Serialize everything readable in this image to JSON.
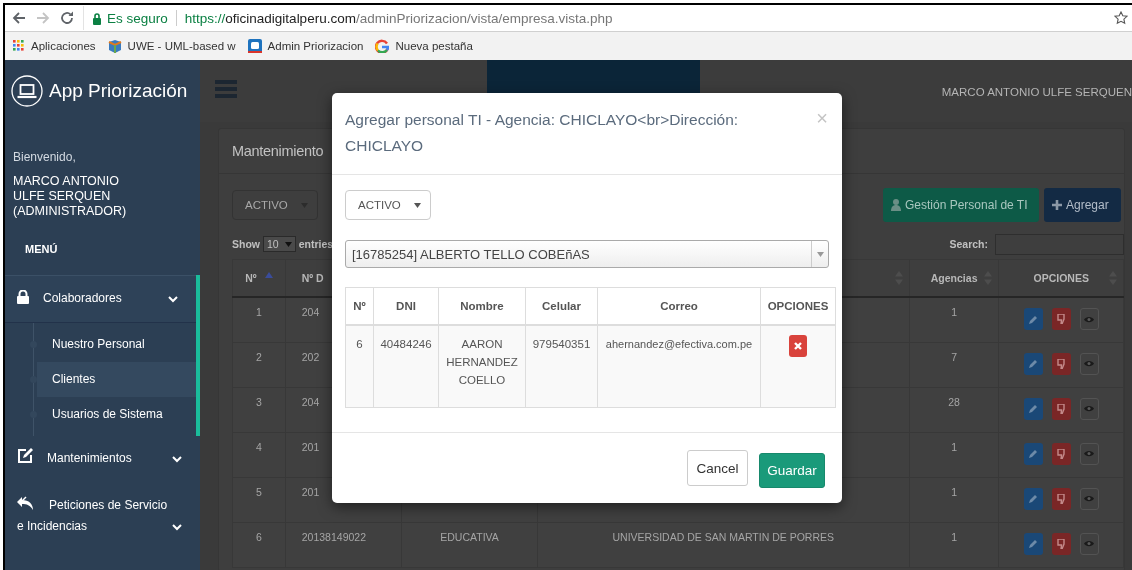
{
  "browser": {
    "security_label": "Es seguro",
    "url_scheme": "https://",
    "url_host": "oficinadigitalperu.com",
    "url_path": "/adminPriorizacion/vista/empresa.vista.php",
    "bookmarks": [
      {
        "label": "Aplicaciones",
        "kind": "apps"
      },
      {
        "label": "UWE - UML-based w",
        "kind": "uwe"
      },
      {
        "label": "Admin Priorizacion",
        "kind": "square"
      },
      {
        "label": "Nueva pestaña",
        "kind": "ring"
      }
    ]
  },
  "sidebar": {
    "brand": "App Priorización",
    "welcome": "Bienvenido,",
    "user_name": "MARCO ANTONIO ULFE SERQUEN (ADMINISTRADOR)",
    "menu_heading": "MENÚ",
    "items": [
      {
        "label": "Colaboradores",
        "expanded": true,
        "children": [
          {
            "label": "Nuestro Personal",
            "selected": false
          },
          {
            "label": "Clientes",
            "selected": true
          },
          {
            "label": "Usuarios de Sistema",
            "selected": false
          }
        ]
      },
      {
        "label": "Mantenimientos",
        "expanded": false
      },
      {
        "label": "Peticiones de Servicio e Incidencias",
        "expanded": false
      }
    ]
  },
  "topbar": {
    "user": "MARCO ANTONIO ULFE SERQUEN"
  },
  "panel": {
    "title": "Mantenimiento",
    "status_filter": "ACTIVO",
    "buttons": [
      {
        "label": "Gestión Personal de TI",
        "kind": "success"
      },
      {
        "label": "Agregar",
        "kind": "primary"
      }
    ],
    "show_label": "Show",
    "page_size": "10",
    "entries_label": "entries",
    "search_label": "Search:",
    "table": {
      "columns": [
        {
          "label": "Nº",
          "sorted": true
        },
        {
          "label": "Nº D"
        },
        {},
        {
          "sorted": false
        },
        {
          "label": "Agencias",
          "sorted": false
        },
        {
          "label": "OPCIONES",
          "sorted": false
        }
      ],
      "rows": [
        {
          "number": "1",
          "doc": "204",
          "agencias": "1"
        },
        {
          "number": "2",
          "doc": "202",
          "agencias": "7"
        },
        {
          "number": "3",
          "doc": "204",
          "agencias": "28"
        },
        {
          "number": "4",
          "doc": "201",
          "agencias": "1"
        },
        {
          "number": "5",
          "doc": "201",
          "agencias": "1"
        },
        {
          "number": "6",
          "doc": "20138149022",
          "type": "EDUCATIVA",
          "name": "UNIVERSIDAD DE SAN MARTIN DE PORRES",
          "agencias": "1"
        }
      ]
    }
  },
  "modal": {
    "title": "Agregar personal TI - Agencia: CHICLAYO<br>Dirección: CHICLAYO",
    "close": "×",
    "status_filter": "ACTIVO",
    "person_select": "[16785254] ALBERTO TELLO COBEñAS",
    "table": {
      "columns": [
        "Nº",
        "DNI",
        "Nombre",
        "Celular",
        "Correo",
        "OPCIONES"
      ],
      "rows": [
        {
          "number": "6",
          "dni": "40484246",
          "name": "AARON HERNANDEZ COELLO",
          "phone": "979540351",
          "email": "ahernandez@efectiva.com.pe"
        }
      ]
    },
    "buttons": [
      {
        "label": "Cancel",
        "kind": "default"
      },
      {
        "label": "Guardar",
        "kind": "success"
      }
    ]
  }
}
